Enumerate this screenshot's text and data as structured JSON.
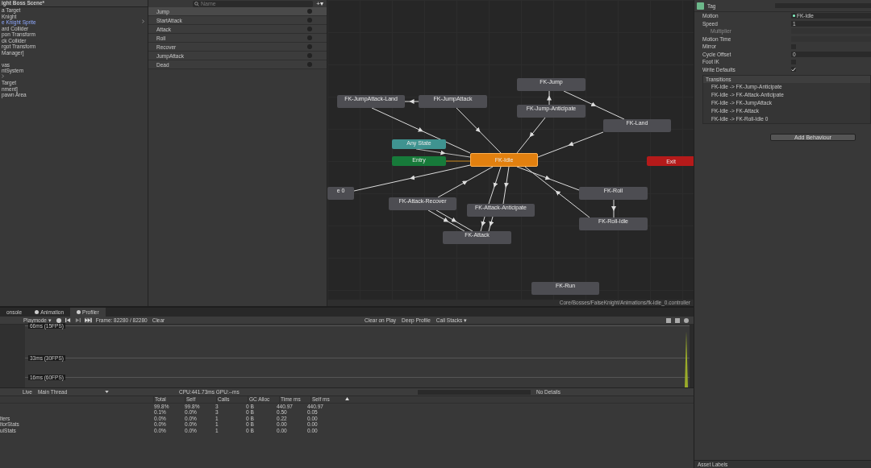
{
  "hierarchy": {
    "scene": "ight Boss Scene*",
    "rows": [
      {
        "kind": "object",
        "label": "a Target",
        "selected": false,
        "has_children": false
      },
      {
        "kind": "object",
        "label": "Knight",
        "selected": false,
        "has_children": false
      },
      {
        "kind": "object",
        "label": "e Knight Sprite",
        "selected": true,
        "has_children": true
      },
      {
        "kind": "object",
        "label": "ard Collider",
        "selected": false,
        "has_children": false
      },
      {
        "kind": "object",
        "label": "pon Transform",
        "selected": false,
        "has_children": false
      },
      {
        "kind": "object",
        "label": "ck Collider",
        "selected": false,
        "has_children": false
      },
      {
        "kind": "object",
        "label": "rgot Transform",
        "selected": false,
        "has_children": false
      },
      {
        "kind": "object",
        "label": "Manager]",
        "selected": false,
        "has_children": false
      },
      {
        "kind": "spacer"
      },
      {
        "kind": "object",
        "label": "vas",
        "selected": false,
        "has_children": false
      },
      {
        "kind": "object",
        "label": "ntSystem",
        "selected": false,
        "has_children": false
      },
      {
        "kind": "spacer",
        "has_children": true
      },
      {
        "kind": "object",
        "label": "Target",
        "selected": false,
        "has_children": false
      },
      {
        "kind": "object",
        "label": "nment]",
        "selected": false,
        "has_children": false
      },
      {
        "kind": "object",
        "label": "pawn Area",
        "selected": false,
        "has_children": false
      }
    ]
  },
  "parameters": {
    "search": {
      "placeholder": "Name"
    },
    "add_button": "+▾",
    "items": [
      {
        "name": "Jump",
        "selected": true
      },
      {
        "name": "StartAttack",
        "selected": false
      },
      {
        "name": "Attack",
        "selected": false
      },
      {
        "name": "Roll",
        "selected": false
      },
      {
        "name": "Recover",
        "selected": false
      },
      {
        "name": "JumpAttack",
        "selected": false
      },
      {
        "name": "Dead",
        "selected": false
      }
    ]
  },
  "graph": {
    "states": [
      {
        "name": "FK-Jump",
        "kind": "state"
      },
      {
        "name": "FK-JumpAttack-Land",
        "kind": "state"
      },
      {
        "name": "FK-JumpAttack",
        "kind": "state"
      },
      {
        "name": "FK-Jump-Anticipate",
        "kind": "state"
      },
      {
        "name": "FK-Land",
        "kind": "state"
      },
      {
        "name": "Any State",
        "kind": "any"
      },
      {
        "name": "Entry",
        "kind": "entry"
      },
      {
        "name": "FK-Idle",
        "kind": "default"
      },
      {
        "name": "Exit",
        "kind": "exit"
      },
      {
        "name": "e 0",
        "kind": "state"
      },
      {
        "name": "FK-Attack-Recover",
        "kind": "state"
      },
      {
        "name": "FK-Attack-Anticipate",
        "kind": "state"
      },
      {
        "name": "FK-Roll",
        "kind": "state"
      },
      {
        "name": "FK-Roll-Idle",
        "kind": "state"
      },
      {
        "name": "FK-Attack",
        "kind": "state"
      },
      {
        "name": "FK-Run",
        "kind": "state"
      }
    ],
    "path": "Core/Bosses/FalseKnight/Animations/fk-idle_0.controller"
  },
  "inspector": {
    "tag_label": "Tag",
    "fields": [
      {
        "kind": "object",
        "label": "Motion",
        "value": "FK-Idle",
        "disabled": false
      },
      {
        "kind": "text",
        "label": "Speed",
        "value": "1",
        "disabled": false
      },
      {
        "kind": "text",
        "label": "Multiplier",
        "disabled": true
      },
      {
        "kind": "text",
        "label": "Motion Time",
        "disabled": false
      },
      {
        "kind": "check",
        "label": "Mirror",
        "checked": false,
        "disabled": false
      },
      {
        "kind": "text",
        "label": "Cycle Offset",
        "value": "0",
        "disabled": false
      },
      {
        "kind": "check",
        "label": "Foot IK",
        "checked": false,
        "disabled": false
      },
      {
        "kind": "check",
        "label": "Write Defaults",
        "checked": true,
        "disabled": false
      }
    ],
    "transitions_title": "Transitions",
    "transitions": [
      "FK-Idle -> FK-Jump-Anticipate",
      "FK-Idle -> FK-Attack-Anticipate",
      "FK-Idle -> FK-JumpAttack",
      "FK-Idle -> FK-Attack",
      "FK-Idle -> FK-Roll-Idle 0"
    ],
    "add_behaviour": "Add Behaviour",
    "asset_labels": "Asset Labels"
  },
  "profiler": {
    "tabs": [
      {
        "label": "onsole",
        "icon": false,
        "selected": false
      },
      {
        "label": "Animation",
        "icon": true,
        "selected": false
      },
      {
        "label": "Profiler",
        "icon": true,
        "selected": true
      }
    ],
    "playmode": "Playmode ▾",
    "frame": "Frame: 82280 / 82280",
    "clear": "Clear",
    "clear_on_play": "Clear on Play",
    "deep_profile": "Deep Profile",
    "call_stacks": "Call Stacks ▾",
    "thresholds": [
      "66ms (15FPS)",
      "33ms (30FPS)",
      "16ms (60FPS)"
    ],
    "live": "Live",
    "thread": "Main Thread",
    "cpu": "CPU:441.73ms   GPU:--ms",
    "details": "No Details",
    "columns": [
      "Total",
      "Self",
      "Calls",
      "GC Alloc",
      "Time ms",
      "Self ms"
    ],
    "rows": [
      {
        "cells": [
          "99.8%",
          "99.8%",
          "3",
          "0 B",
          "440.97",
          "440.97"
        ]
      },
      {
        "cells": [
          "0.1%",
          "0.0%",
          "3",
          "0 B",
          "0.50",
          "0.05"
        ]
      },
      {
        "name": "lters",
        "cells": [
          "0.0%",
          "0.0%",
          "1",
          "0 B",
          "0.22",
          "0.00"
        ]
      },
      {
        "name": "itorStats",
        "cells": [
          "0.0%",
          "0.0%",
          "1",
          "0 B",
          "0.00",
          "0.00"
        ]
      },
      {
        "name": "uiStats",
        "cells": [
          "0.0%",
          "0.0%",
          "1",
          "0 B",
          "0.00",
          "0.00"
        ]
      }
    ]
  }
}
